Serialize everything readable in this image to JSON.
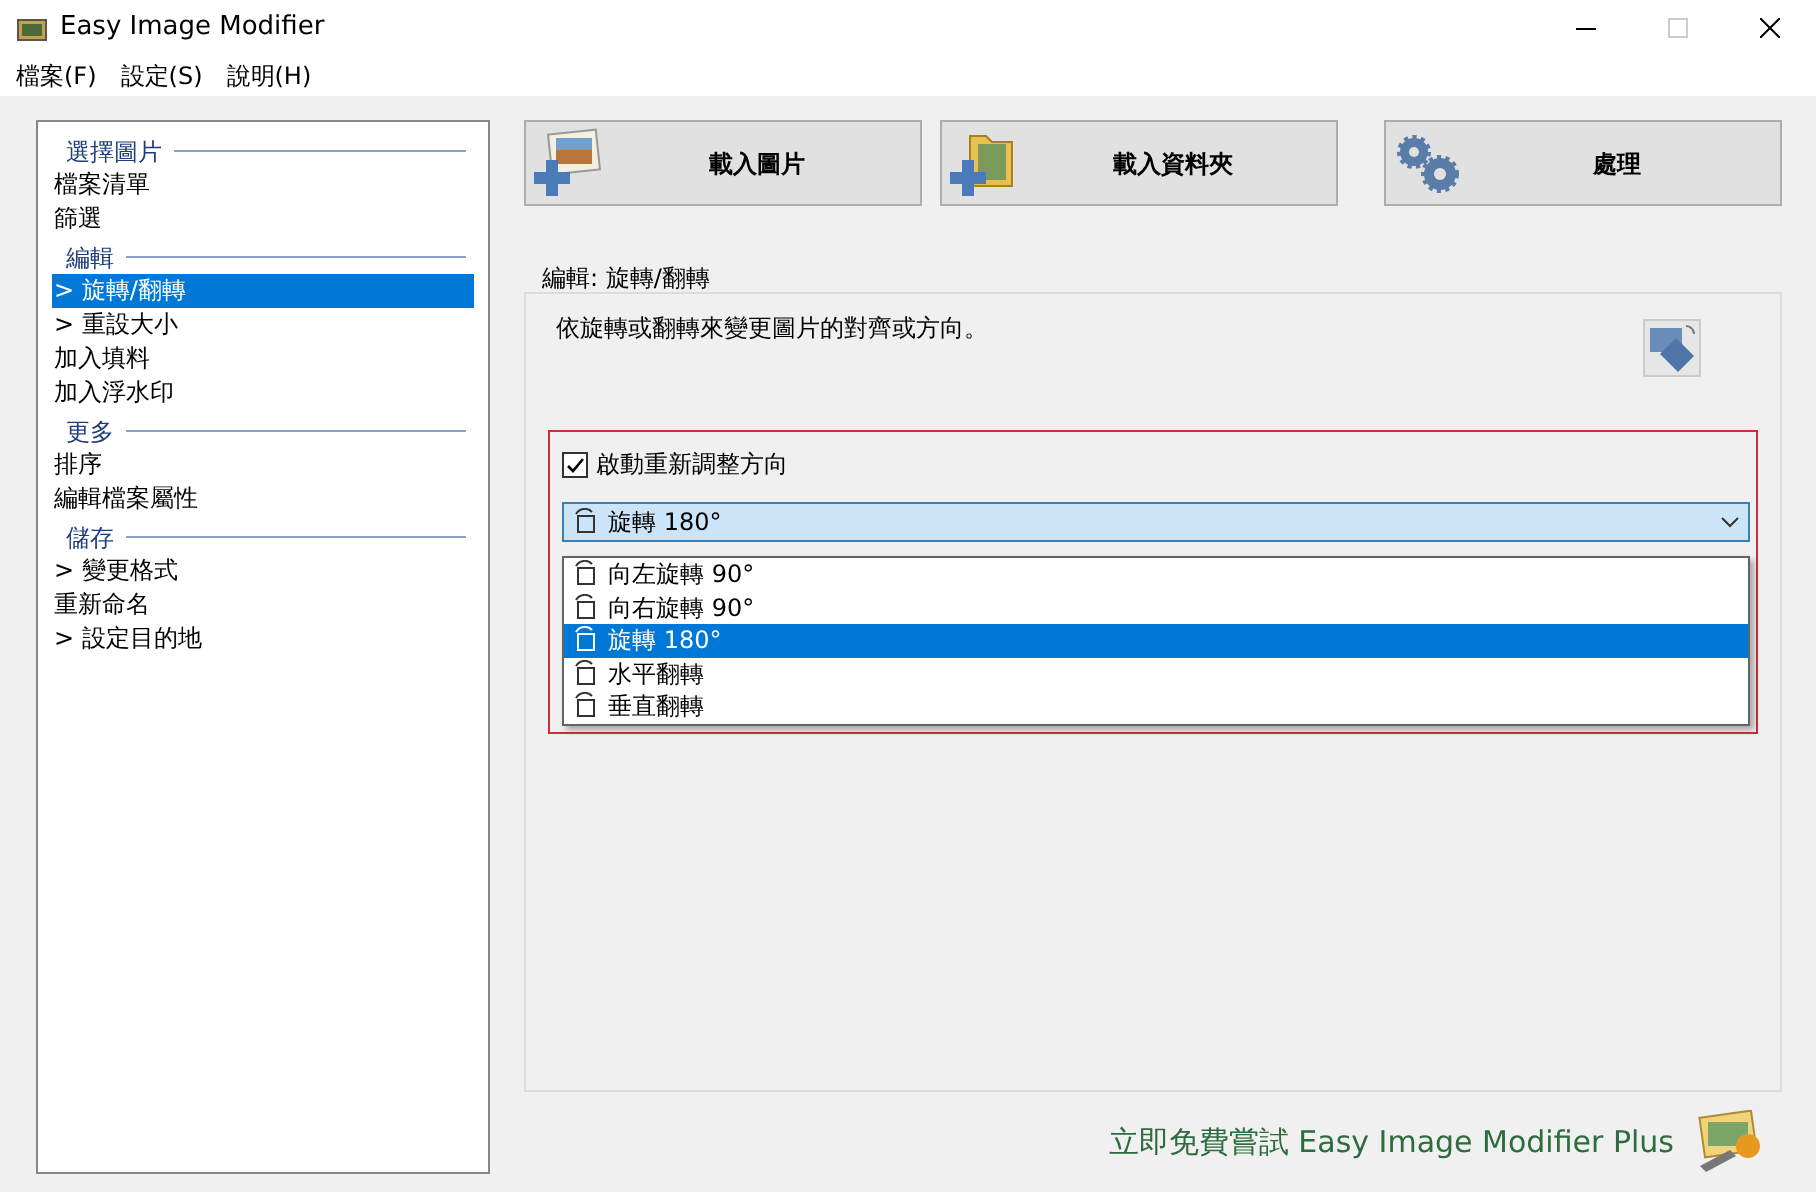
{
  "window": {
    "title": "Easy Image Modifier"
  },
  "menu": [
    "檔案(F)",
    "設定(S)",
    "說明(H)"
  ],
  "sidebar": {
    "sections": [
      {
        "heading": "選擇圖片",
        "items": [
          {
            "label": "檔案清單",
            "selected": false
          },
          {
            "label": "篩選",
            "selected": false
          }
        ]
      },
      {
        "heading": "編輯",
        "items": [
          {
            "label": "> 旋轉/翻轉",
            "selected": true
          },
          {
            "label": "> 重設大小",
            "selected": false
          },
          {
            "label": "加入填料",
            "selected": false
          },
          {
            "label": "加入浮水印",
            "selected": false
          }
        ]
      },
      {
        "heading": "更多",
        "items": [
          {
            "label": "排序",
            "selected": false
          },
          {
            "label": "編輯檔案屬性",
            "selected": false
          }
        ]
      },
      {
        "heading": "儲存",
        "items": [
          {
            "label": "> 變更格式",
            "selected": false
          },
          {
            "label": "重新命名",
            "selected": false
          },
          {
            "label": "> 設定目的地",
            "selected": false
          }
        ]
      }
    ]
  },
  "toolbar": [
    {
      "label": "載入圖片",
      "kind": "image"
    },
    {
      "label": "載入資料夾",
      "kind": "folder"
    },
    {
      "label": "處理",
      "kind": "gears"
    }
  ],
  "group": {
    "title": "編輯: 旋轉/翻轉",
    "description": "依旋轉或翻轉來變更圖片的對齊或方向。",
    "auto_orient": {
      "label": "啟動重新調整方向",
      "checked": true
    },
    "combo": {
      "value": "旋轉 180°",
      "expanded": true,
      "options": [
        {
          "label": "向左旋轉 90°",
          "selected": false
        },
        {
          "label": "向右旋轉 90°",
          "selected": false
        },
        {
          "label": "旋轉 180°",
          "selected": true
        },
        {
          "label": "水平翻轉",
          "selected": false
        },
        {
          "label": "垂直翻轉",
          "selected": false
        }
      ]
    }
  },
  "promo": "立即免費嘗試 Easy Image Modifier Plus"
}
